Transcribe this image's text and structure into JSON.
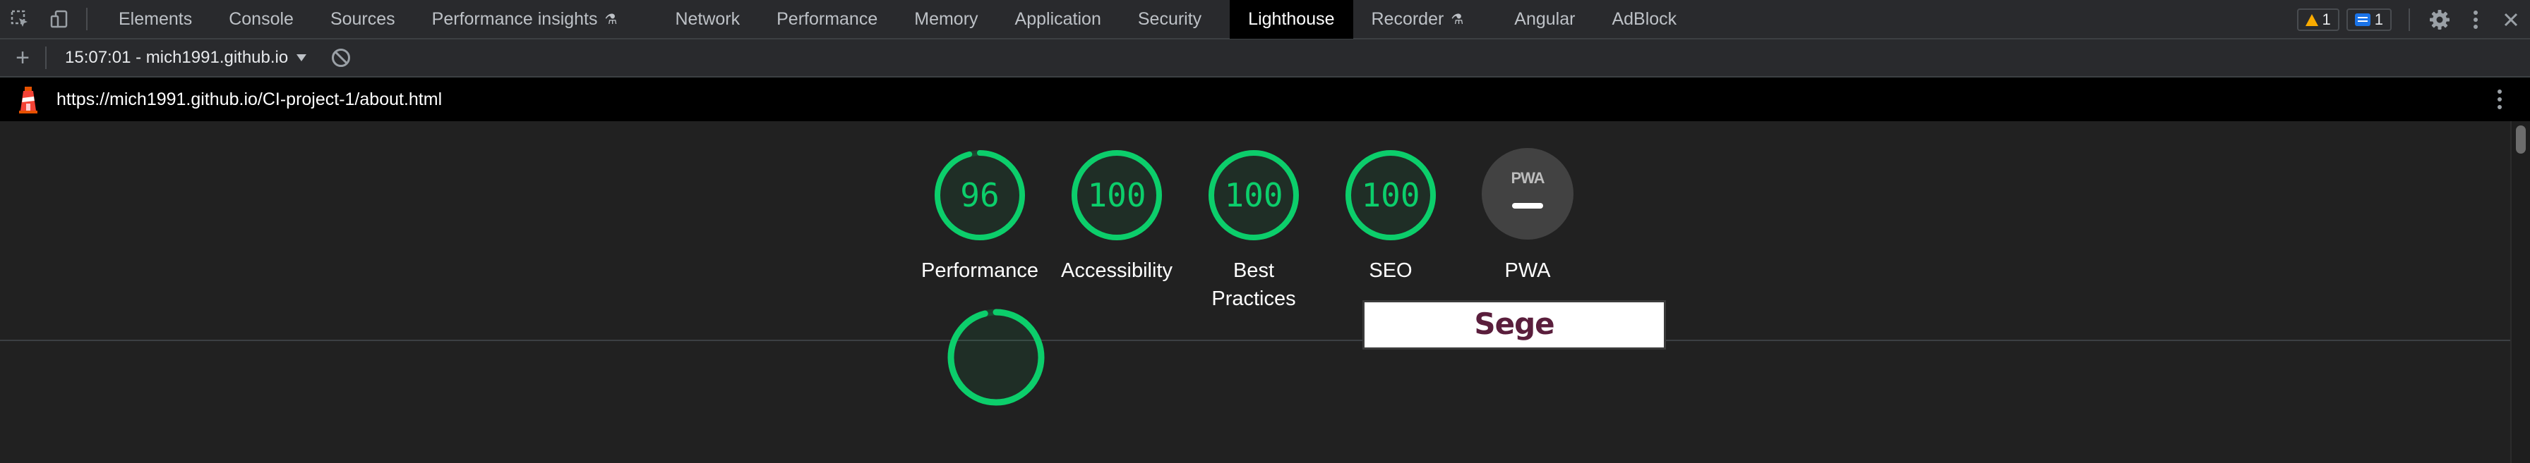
{
  "devtools": {
    "tabs": [
      {
        "label": "Elements"
      },
      {
        "label": "Console"
      },
      {
        "label": "Sources"
      },
      {
        "label": "Performance insights"
      },
      {
        "label": "Network"
      },
      {
        "label": "Performance"
      },
      {
        "label": "Memory"
      },
      {
        "label": "Application"
      },
      {
        "label": "Security"
      },
      {
        "label": "Lighthouse"
      },
      {
        "label": "Recorder"
      },
      {
        "label": "Angular"
      },
      {
        "label": "AdBlock"
      }
    ],
    "active_tab": "Lighthouse",
    "warnings_count": "1",
    "messages_count": "1"
  },
  "toolbar": {
    "report_selector": "15:07:01 - mich1991.github.io"
  },
  "urlbar": {
    "url": "https://mich1991.github.io/CI-project-1/about.html"
  },
  "scores": [
    {
      "label_line1": "Performance",
      "label_line2": "",
      "score": "96",
      "value": 96
    },
    {
      "label_line1": "Accessibility",
      "label_line2": "",
      "score": "100",
      "value": 100
    },
    {
      "label_line1": "Best",
      "label_line2": "Practices",
      "score": "100",
      "value": 100
    },
    {
      "label_line1": "SEO",
      "label_line2": "",
      "score": "100",
      "value": 100
    }
  ],
  "pwa": {
    "label": "PWA",
    "badge_text": "PWA"
  },
  "preview": {
    "thumbnail_text": "Sege"
  },
  "colors": {
    "score_good": "#0cce6b",
    "background": "#212121",
    "tab_active_bg": "#000000"
  }
}
